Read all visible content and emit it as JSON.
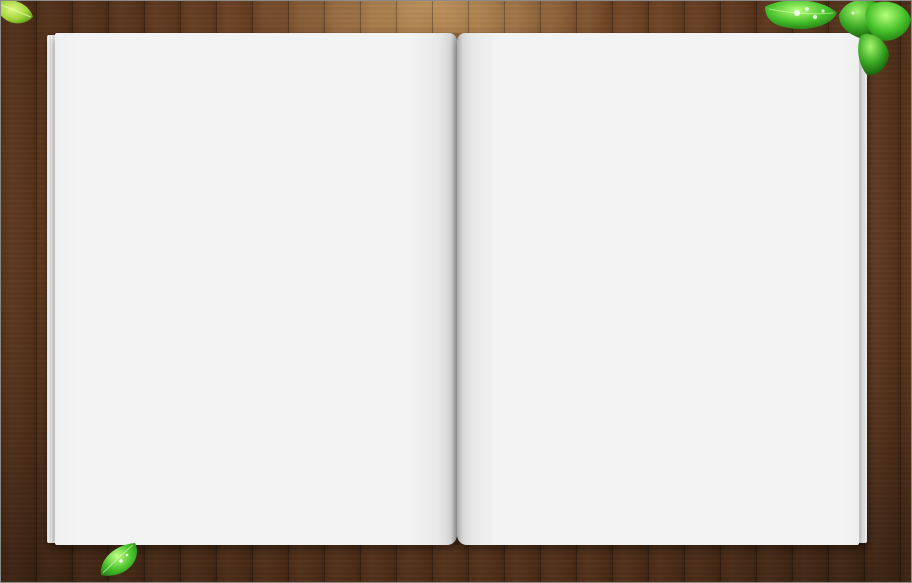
{
  "scene": {
    "background": "wooden-plank-table",
    "colors": {
      "wood_dark": "#5e361c",
      "wood_light": "#74472a",
      "page": "#f3f3f3",
      "leaf_green": "#3fb52a",
      "leaf_highlight": "#9be86a"
    }
  },
  "book": {
    "left_page_text": "",
    "right_page_text": ""
  },
  "decorations": {
    "leaf_icons": [
      "leaf-top-left-icon",
      "leaf-cluster-top-right-icon",
      "leaf-bottom-left-icon"
    ]
  }
}
